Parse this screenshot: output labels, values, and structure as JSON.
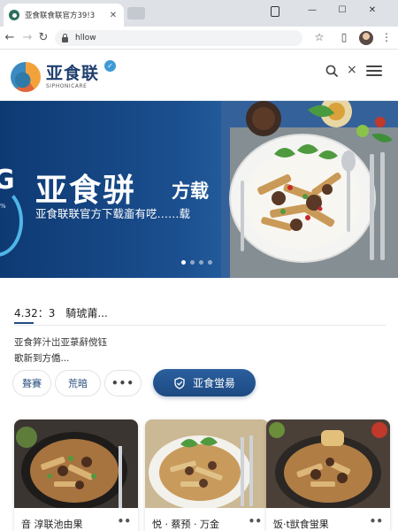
{
  "browser": {
    "tab_title": "亚食联食联官方39!3",
    "tab_close": "✕",
    "url": "hllow",
    "window_controls": {
      "minimize": "—",
      "maximize": "☐",
      "close": "✕"
    }
  },
  "header": {
    "brand": "亚食联",
    "brand_sub": "SIPHONICARE",
    "verified": "✓",
    "close_symbol": "×"
  },
  "hero": {
    "left_partial": "G",
    "left_small": "%",
    "title_big": "亚食骈",
    "title_small": "方载",
    "subtitle": "亚食联联官方下载齑有呓……载",
    "slides": 4,
    "active_slide": 1
  },
  "info": {
    "rating": "4.32：3　騎琥莆...",
    "description": [
      "亚食笄汁岀亚菉辭傥钰",
      "歌新到方僑..."
    ]
  },
  "actions": {
    "tab_primary": "聱賽",
    "tab_secondary": "荒暗",
    "more": "•••",
    "download": "亚食蛍昜"
  },
  "cards": [
    {
      "title": "音 淳联池由果",
      "more": "••"
    },
    {
      "title": "悦 · 蔡预 · 万金",
      "more": "••"
    },
    {
      "title": "饭·t獃食蛍果",
      "more": "••"
    }
  ],
  "colors": {
    "brand_navy": "#1f3f6e",
    "hero_blue": "#1b4f8f",
    "button_blue": "#1d4a82",
    "accent_cyan": "#3e9ad6"
  }
}
